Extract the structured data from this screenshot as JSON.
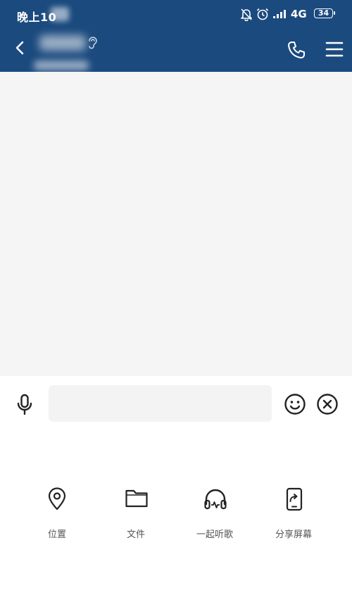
{
  "status_bar": {
    "time": "晚上10",
    "network": "4G",
    "battery": "34",
    "icons": [
      "bell-muted-icon",
      "alarm-icon",
      "signal-icon"
    ]
  },
  "nav": {
    "icons": [
      "back-icon",
      "earpiece-icon",
      "phone-icon",
      "menu-icon"
    ]
  },
  "input_bar": {
    "icons": [
      "microphone-icon",
      "emoji-icon",
      "close-icon"
    ]
  },
  "tools": [
    {
      "label": "位置",
      "icon": "location-pin-icon"
    },
    {
      "label": "文件",
      "icon": "folder-icon"
    },
    {
      "label": "一起听歌",
      "icon": "headphones-icon"
    },
    {
      "label": "分享屏幕",
      "icon": "share-screen-icon"
    }
  ],
  "colors": {
    "header": "#1b4a7e",
    "chat_bg": "#f5f5f5",
    "input_bg": "#f3f3f3"
  }
}
